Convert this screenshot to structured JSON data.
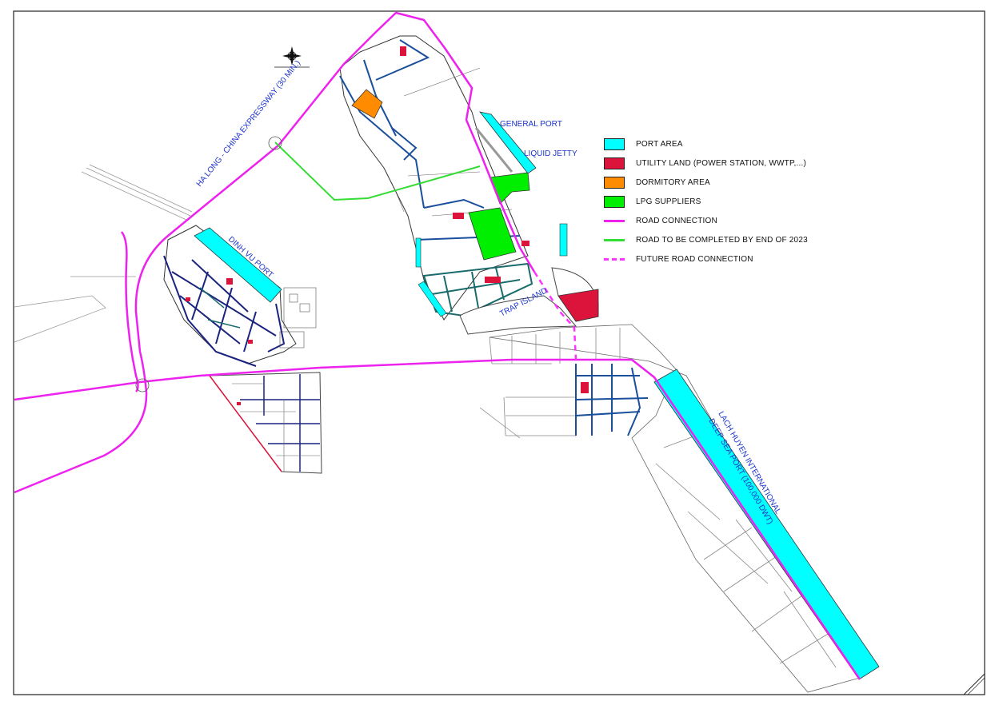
{
  "labels": {
    "expressway": "HA LONG - CHINA EXPRESSWAY (30 MIN.)",
    "general_port": "GENERAL PORT",
    "liquid_jetty": "LIQUID JETTY",
    "dinh_vu_port": "DINH VU PORT",
    "trap_island": "TRAP ISLAND",
    "lach_huyen_line1": "LACH HUYEN INTERNATIONAL",
    "lach_huyen_line2": "DEEP SEA PORT (100,000 DWT)"
  },
  "legend": {
    "items": [
      {
        "kind": "swatch",
        "label": "PORT AREA",
        "color": "#00ffff"
      },
      {
        "kind": "swatch",
        "label": "UTILITY LAND (POWER STATION, WWTP,...)",
        "color": "#dc143c"
      },
      {
        "kind": "swatch",
        "label": "DORMITORY AREA",
        "color": "#ff8c00"
      },
      {
        "kind": "swatch",
        "label": "LPG SUPPLIERS",
        "color": "#00ee00"
      },
      {
        "kind": "line",
        "label": "ROAD CONNECTION",
        "color": "#ee22ee"
      },
      {
        "kind": "line",
        "label": "ROAD TO BE COMPLETED BY END OF 2023",
        "color": "#33dd33"
      },
      {
        "kind": "dash",
        "label": "FUTURE ROAD CONNECTION",
        "color": "#ff33ff"
      }
    ]
  },
  "colors": {
    "port": "#00ffff",
    "utility": "#dc143c",
    "dormitory": "#ff8c00",
    "lpg": "#00ee00",
    "road": "#ee22ee",
    "road_2023": "#33dd33",
    "future_road": "#ff33ff",
    "label_text": "#1a33cc"
  },
  "icons": {
    "north_arrow": "compass-rose-icon"
  }
}
